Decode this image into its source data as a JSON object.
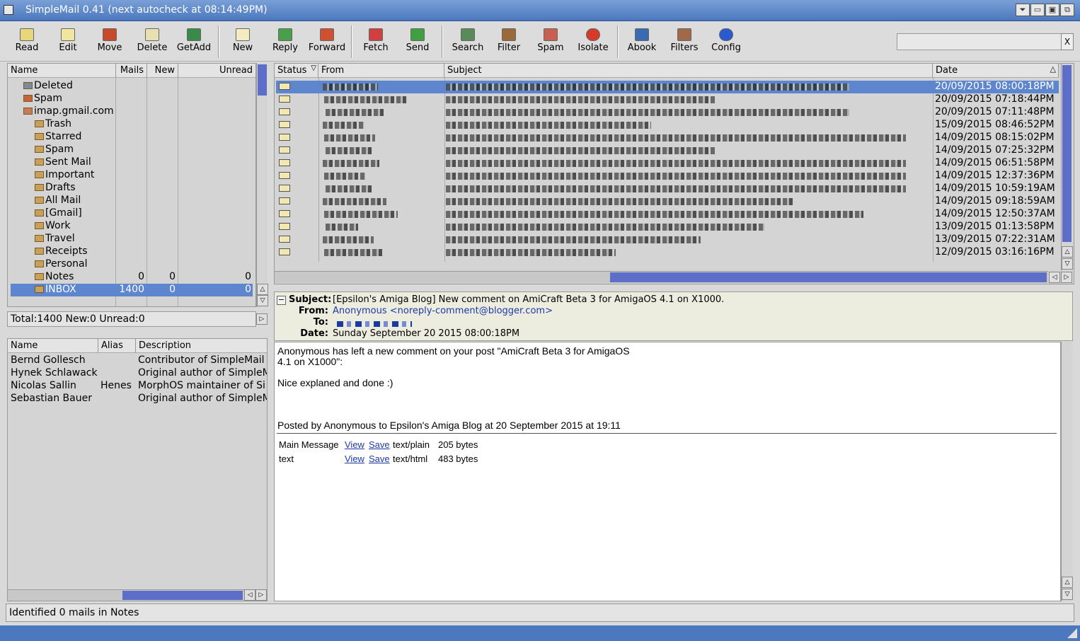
{
  "window": {
    "title": "SimpleMail 0.41 (next autocheck at 08:14:49PM)"
  },
  "toolbar": {
    "buttons": [
      {
        "label": "Read",
        "icon": "read-icon"
      },
      {
        "label": "Edit",
        "icon": "edit-icon"
      },
      {
        "label": "Move",
        "icon": "move-icon"
      },
      {
        "label": "Delete",
        "icon": "delete-icon"
      },
      {
        "label": "GetAdd",
        "icon": "getadd-icon"
      },
      {
        "label": "New",
        "icon": "new-icon"
      },
      {
        "label": "Reply",
        "icon": "reply-icon"
      },
      {
        "label": "Forward",
        "icon": "forward-icon"
      },
      {
        "label": "Fetch",
        "icon": "fetch-icon"
      },
      {
        "label": "Send",
        "icon": "send-icon"
      },
      {
        "label": "Search",
        "icon": "search-icon"
      },
      {
        "label": "Filter",
        "icon": "filter-icon"
      },
      {
        "label": "Spam",
        "icon": "spam-icon"
      },
      {
        "label": "Isolate",
        "icon": "isolate-icon"
      },
      {
        "label": "Abook",
        "icon": "abook-icon"
      },
      {
        "label": "Filters",
        "icon": "filters-icon"
      },
      {
        "label": "Config",
        "icon": "config-icon"
      }
    ],
    "search_clear": "X"
  },
  "folders": {
    "headers": {
      "name": "Name",
      "mails": "Mails",
      "new": "New",
      "unread": "Unread"
    },
    "items": [
      {
        "name": "Deleted",
        "mails": "",
        "new": "",
        "unread": ""
      },
      {
        "name": "Spam",
        "mails": "",
        "new": "",
        "unread": ""
      },
      {
        "name": "imap.gmail.com",
        "mails": "",
        "new": "",
        "unread": ""
      },
      {
        "name": "Trash",
        "mails": "",
        "new": "",
        "unread": ""
      },
      {
        "name": "Starred",
        "mails": "",
        "new": "",
        "unread": ""
      },
      {
        "name": "Spam",
        "mails": "",
        "new": "",
        "unread": ""
      },
      {
        "name": "Sent Mail",
        "mails": "",
        "new": "",
        "unread": ""
      },
      {
        "name": "Important",
        "mails": "",
        "new": "",
        "unread": ""
      },
      {
        "name": "Drafts",
        "mails": "",
        "new": "",
        "unread": ""
      },
      {
        "name": "All Mail",
        "mails": "",
        "new": "",
        "unread": ""
      },
      {
        "name": "[Gmail]",
        "mails": "",
        "new": "",
        "unread": ""
      },
      {
        "name": "Work",
        "mails": "",
        "new": "",
        "unread": ""
      },
      {
        "name": "Travel",
        "mails": "",
        "new": "",
        "unread": ""
      },
      {
        "name": "Receipts",
        "mails": "",
        "new": "",
        "unread": ""
      },
      {
        "name": "Personal",
        "mails": "",
        "new": "",
        "unread": ""
      },
      {
        "name": "Notes",
        "mails": "0",
        "new": "0",
        "unread": "0"
      },
      {
        "name": "INBOX",
        "mails": "1400",
        "new": "0",
        "unread": "0"
      }
    ],
    "total": "Total:1400 New:0 Unread:0"
  },
  "addressbook": {
    "headers": {
      "name": "Name",
      "alias": "Alias",
      "description": "Description"
    },
    "rows": [
      {
        "name": "Bernd Gollesch",
        "alias": "",
        "description": "Contributor of SimpleMail"
      },
      {
        "name": "Hynek Schlawack",
        "alias": "",
        "description": "Original author of SimpleM"
      },
      {
        "name": "Nicolas Sallin",
        "alias": "Henes",
        "description": "MorphOS maintainer of Si"
      },
      {
        "name": "Sebastian Bauer",
        "alias": "",
        "description": "Original author of SimpleM"
      }
    ]
  },
  "messages": {
    "headers": {
      "status": "Status",
      "from": "From",
      "subject": "Subject",
      "date": "Date"
    },
    "dates": [
      "20/09/2015 08:00:18PM",
      "20/09/2015 07:18:44PM",
      "20/09/2015 07:11:48PM",
      "15/09/2015 08:46:52PM",
      "14/09/2015 08:15:02PM",
      "14/09/2015 07:25:32PM",
      "14/09/2015 06:51:58PM",
      "14/09/2015 12:37:36PM",
      "14/09/2015 10:59:19AM",
      "14/09/2015 09:18:59AM",
      "14/09/2015 12:50:37AM",
      "13/09/2015 01:13:58PM",
      "13/09/2015 07:22:31AM",
      "12/09/2015 03:16:16PM"
    ]
  },
  "preview": {
    "toggle": "−",
    "subject_label": "Subject:",
    "subject": "[Epsilon's Amiga Blog] New comment on AmiCraft Beta 3 for AmigaOS 4.1 on X1000.",
    "from_label": "From:",
    "from": "Anonymous <noreply-comment@blogger.com>",
    "to_label": "To:",
    "date_label": "Date:",
    "date": "Sunday September 20 2015 08:00:18PM",
    "body_line1": "Anonymous has left a new comment on your post \"AmiCraft Beta 3 for AmigaOS",
    "body_line2": "4.1 on X1000\":",
    "body_line3": "Nice explaned and done :)",
    "body_line4": "Posted by Anonymous to Epsilon's Amiga Blog at 20 September 2015 at 19:11",
    "parts": [
      {
        "name": "Main Message",
        "view": "View",
        "save": "Save",
        "type": "text/plain",
        "size": "205 bytes"
      },
      {
        "name": "text",
        "view": "View",
        "save": "Save",
        "type": "text/html",
        "size": "483 bytes"
      }
    ]
  },
  "status": "Identified 0 mails in Notes"
}
